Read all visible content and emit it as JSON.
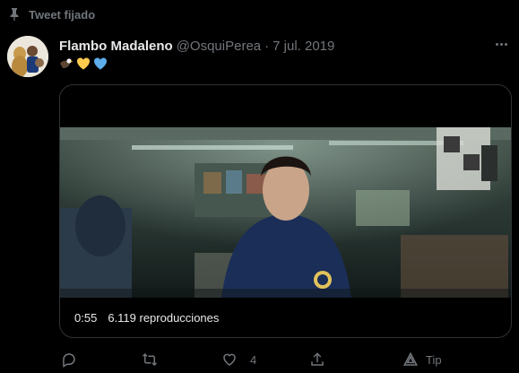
{
  "pinned": {
    "label": "Tweet fijado",
    "icon": "pin-icon"
  },
  "tweet": {
    "author_name": "Flambo Madaleno",
    "handle": "@OsquiPerea",
    "separator": "·",
    "date": "7 jul. 2019",
    "emojis": [
      "eagle-emoji",
      "yellow-heart-emoji",
      "blue-heart-emoji"
    ]
  },
  "video": {
    "duration": "0:55",
    "views": "6.119 reproducciones"
  },
  "actions": {
    "reply_count": "",
    "retweet_count": "",
    "like_count": "4",
    "tip_label": "Tip"
  },
  "colors": {
    "background": "#000000",
    "text": "#e7e9ea",
    "muted": "#71767b",
    "border": "#2f3336",
    "yellow_heart": "#ffcc4d",
    "blue_heart": "#5dadec"
  }
}
